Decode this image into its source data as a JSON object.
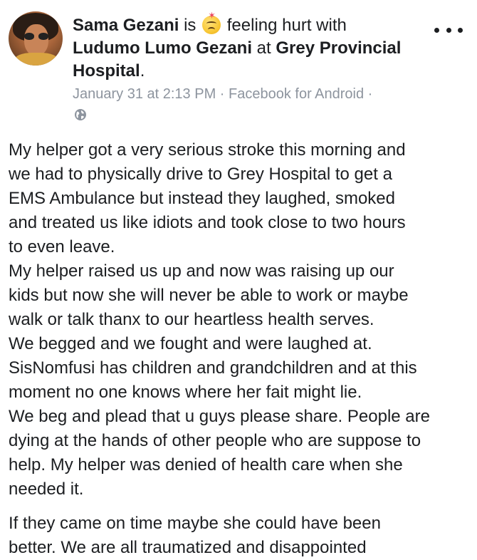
{
  "post": {
    "author": "Sama Gezani",
    "is_word": "is",
    "feeling": "feeling hurt with",
    "tagged": "Ludumo Lumo Gezani",
    "at_word": "at",
    "location_line1": "Grey Provincial",
    "location_line2": "Hospital",
    "period": ".",
    "meta": "January 31 at 2:13 PM · Facebook for Android ·",
    "privacy_icon": "globe-icon",
    "more_icon": "more-options-icon",
    "body_lines": [
      "My helper got a very serious stroke this morning and",
      "we had to physically drive to Grey Hospital to get a",
      "EMS Ambulance but instead they laughed, smoked",
      "and treated us like idiots and took close to two hours",
      "to even leave.",
      "My helper raised us up and now was raising up our",
      "kids but now she will never be able to work or maybe",
      "walk or talk thanx to our heartless health serves.",
      "We begged and we fought and were laughed at.",
      "SisNomfusi has children and grandchildren and at this",
      "moment no one knows where her fait might lie.",
      "We beg and plead that u guys please share. People are",
      "dying at the hands of other people who are suppose to",
      "help. My helper was denied of health care when she",
      "needed it."
    ],
    "body_lines_2": [
      "If they came on time maybe she could have been",
      "better. We are all traumatized and disappointed"
    ]
  }
}
